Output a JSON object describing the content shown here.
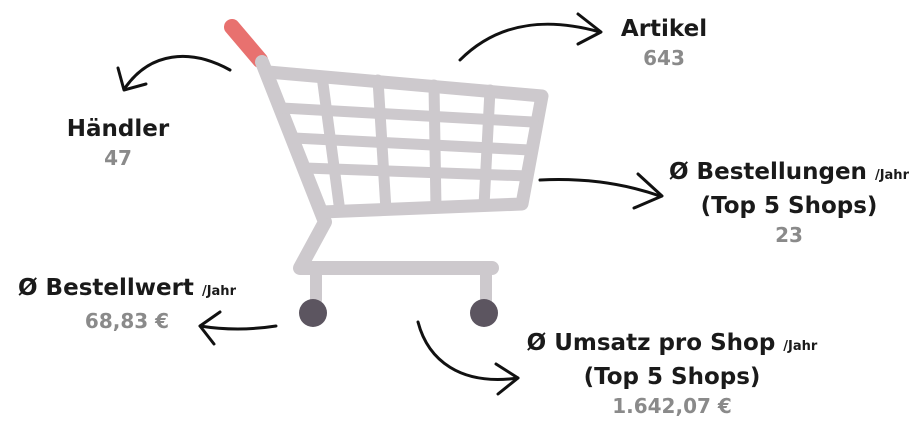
{
  "stats": {
    "artikel": {
      "label": "Artikel",
      "value": "643"
    },
    "haendler": {
      "label": "Händler",
      "value": "47"
    },
    "bestellungen": {
      "label": "Ø Bestellungen",
      "suffix": "/Jahr",
      "sub": "(Top 5 Shops)",
      "value": "23"
    },
    "bestellwert": {
      "label": "Ø Bestellwert",
      "suffix": "/Jahr",
      "value": "68,83 €"
    },
    "umsatz": {
      "label": "Ø Umsatz pro Shop",
      "suffix": "/Jahr",
      "sub": "(Top 5 Shops)",
      "value": "1.642,07 €"
    }
  },
  "icons": [
    "shopping-cart-icon",
    "arrow-icon"
  ],
  "colors": {
    "cart": "#cdc9cd",
    "handle": "#e8716f",
    "wheel": "#5c5560",
    "label": "#1a1a1a",
    "value": "#8a8a8a"
  }
}
